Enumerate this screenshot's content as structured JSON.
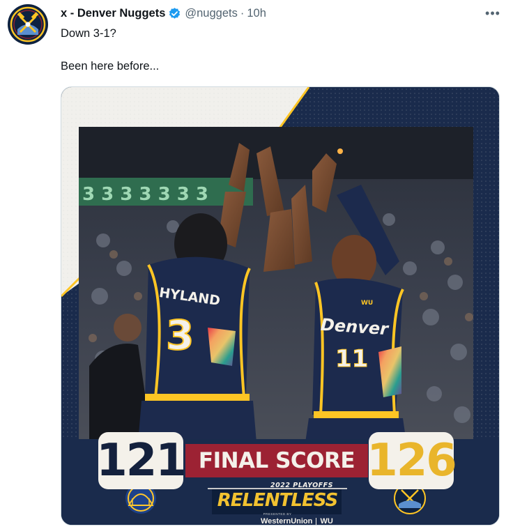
{
  "tweet": {
    "display_name": "x - Denver Nuggets",
    "handle": "@nuggets",
    "separator": "·",
    "time": "10h",
    "more_label": "•••",
    "text_line_1": "Down 3-1?",
    "text_line_2": "Been here before..."
  },
  "graphic": {
    "away_score": "121",
    "home_score": "126",
    "banner": "FINAL SCORE",
    "playoffs_label": "2022 PLAYOFFS",
    "campaign": "RELENTLESS",
    "presented_by": "PRESENTED BY",
    "sponsor": "WesternUnion",
    "sponsor_mark": "WU",
    "player_left_name": "HYLAND",
    "player_left_number": "3",
    "player_right_team": "Denver",
    "player_right_number": "11",
    "player_right_patch": "WU"
  },
  "colors": {
    "nuggets_navy": "#0e2240",
    "nuggets_gold": "#fec524",
    "final_red": "#9c2233",
    "verified_blue": "#1d9bf0"
  },
  "icons": {
    "avatar": "denver-nuggets-logo",
    "verified": "verified-badge-icon",
    "more": "more-options-icon",
    "away_team": "golden-state-warriors-logo",
    "home_team": "denver-nuggets-logo"
  }
}
